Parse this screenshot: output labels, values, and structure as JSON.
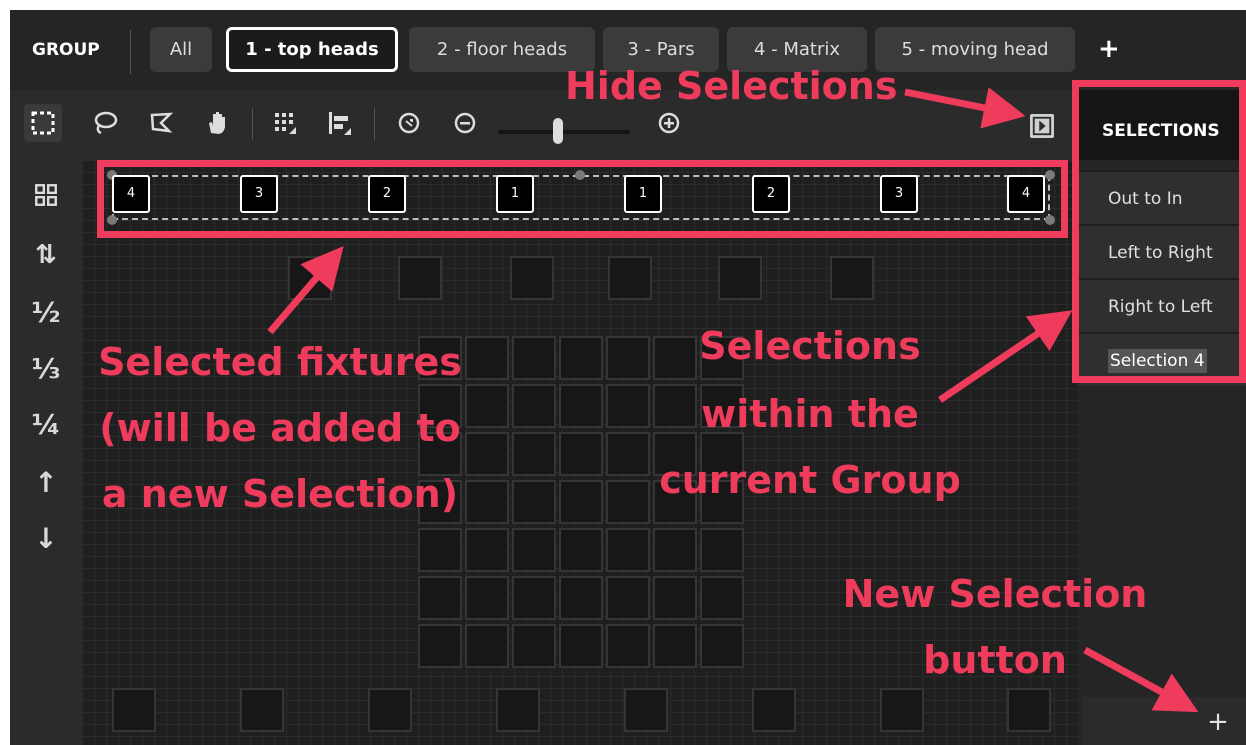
{
  "group": {
    "label": "GROUP",
    "tabs": [
      {
        "label": "All"
      },
      {
        "label": "1 - top heads"
      },
      {
        "label": "2 - floor heads"
      },
      {
        "label": "3 - Pars"
      },
      {
        "label": "4 - Matrix"
      },
      {
        "label": "5 - moving head"
      }
    ],
    "active_tab": "1 - top heads",
    "add_tab_label": "+"
  },
  "toolbar": {
    "icons": [
      "rect-select-icon",
      "lasso-icon",
      "polygon-lasso-icon",
      "hand-icon",
      "grid-snap-icon",
      "align-icon",
      "zoom-fit-icon",
      "zoom-out-icon",
      "zoom-slider",
      "zoom-in-icon"
    ],
    "zoom_level": 0.45
  },
  "leftbar": {
    "tools": [
      {
        "icon": "grid-icon",
        "label": "▦"
      },
      {
        "icon": "sort-icon",
        "label": "⇅"
      },
      {
        "icon": "half-icon",
        "label": "½"
      },
      {
        "icon": "third-icon",
        "label": "⅓"
      },
      {
        "icon": "quarter-icon",
        "label": "¼"
      },
      {
        "icon": "arrow-up-icon",
        "label": "↑"
      },
      {
        "icon": "arrow-down-icon",
        "label": "↓"
      }
    ]
  },
  "canvas": {
    "selected_fixtures": [
      "4",
      "3",
      "2",
      "1",
      "1",
      "2",
      "3",
      "4"
    ]
  },
  "selections": {
    "header": "SELECTIONS",
    "items": [
      "Out to In",
      "Left to Right",
      "Right to Left",
      "Selection 4"
    ],
    "new_button_label": "+"
  },
  "annotations": {
    "hide_selections": "Hide Selections",
    "selected_fixtures_1": "Selected fixtures",
    "selected_fixtures_2": "(will be added to",
    "selected_fixtures_3": "a new Selection)",
    "selections_within_1": "Selections",
    "selections_within_2": "within the",
    "selections_within_3": "current Group",
    "new_selection_1": "New Selection",
    "new_selection_2": "button"
  },
  "colors": {
    "annotation": "#ef3b5c",
    "background": "#1e1e1e",
    "active_tab_border": "#ffffff"
  }
}
